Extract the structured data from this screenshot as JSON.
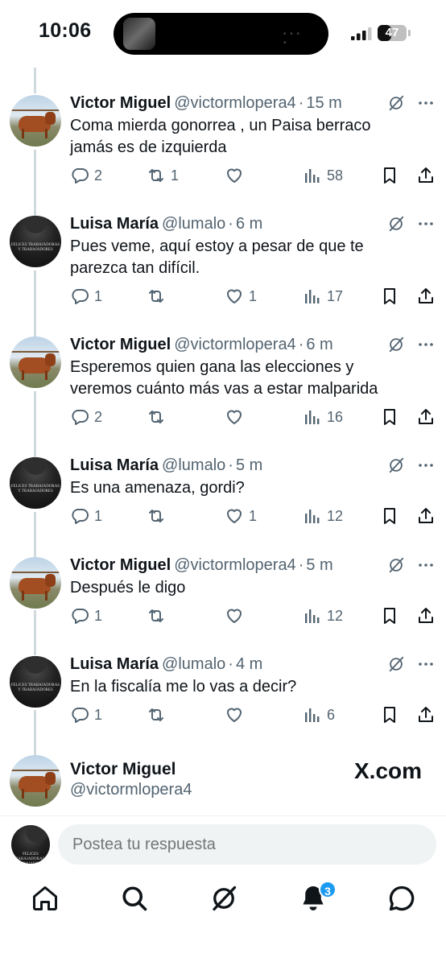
{
  "status_bar": {
    "time": "10:06",
    "battery": "47",
    "battery_level": 0.47
  },
  "tweets": [
    {
      "name": "Victor Miguel",
      "handle": "@victormlopera4",
      "time": "15 m",
      "text": "Coma  mierda gonorrea , un Paisa berraco jamás es de izquierda",
      "avatar": "cow",
      "replies": "2",
      "retweets": "1",
      "likes": "",
      "views": "58"
    },
    {
      "name": "Luisa María",
      "handle": "@lumalo",
      "time": "6 m",
      "text": "Pues veme, aquí estoy a pesar de que te parezca tan difícil.",
      "avatar": "dark",
      "replies": "1",
      "retweets": "",
      "likes": "1",
      "views": "17"
    },
    {
      "name": "Victor Miguel",
      "handle": "@victormlopera4",
      "time": "6 m",
      "text": "Esperemos quien gana las elecciones y veremos cuánto más vas a estar malparida",
      "avatar": "cow",
      "replies": "2",
      "retweets": "",
      "likes": "",
      "views": "16"
    },
    {
      "name": "Luisa María",
      "handle": "@lumalo",
      "time": "5 m",
      "text": "Es una amenaza, gordi?",
      "avatar": "dark",
      "replies": "1",
      "retweets": "",
      "likes": "1",
      "views": "12"
    },
    {
      "name": "Victor Miguel",
      "handle": "@victormlopera4",
      "time": "5 m",
      "text": "Después le digo",
      "avatar": "cow",
      "replies": "1",
      "retweets": "",
      "likes": "",
      "views": "12"
    },
    {
      "name": "Luisa María",
      "handle": "@lumalo",
      "time": "4 m",
      "text": "En la fiscalía me lo vas a decir?",
      "avatar": "dark",
      "replies": "1",
      "retweets": "",
      "likes": "",
      "views": "6"
    }
  ],
  "last_reply": {
    "name": "Victor Miguel",
    "handle": "@victormlopera4",
    "avatar": "cow"
  },
  "watermark": "X.com",
  "reply_bar": {
    "placeholder": "Postea tu respuesta"
  },
  "avatar_caption": "FELICES TRABAJADORAS Y TRABAJADORES",
  "bottom_nav": {
    "items": [
      "home-icon",
      "search-icon",
      "grok-icon",
      "notifications-icon",
      "messages-icon"
    ],
    "notifications_badge": "3"
  },
  "colors": {
    "text": "#0f1419",
    "secondary": "#536471",
    "accent": "#1d9bf0",
    "thread_line": "#cfd9de"
  }
}
